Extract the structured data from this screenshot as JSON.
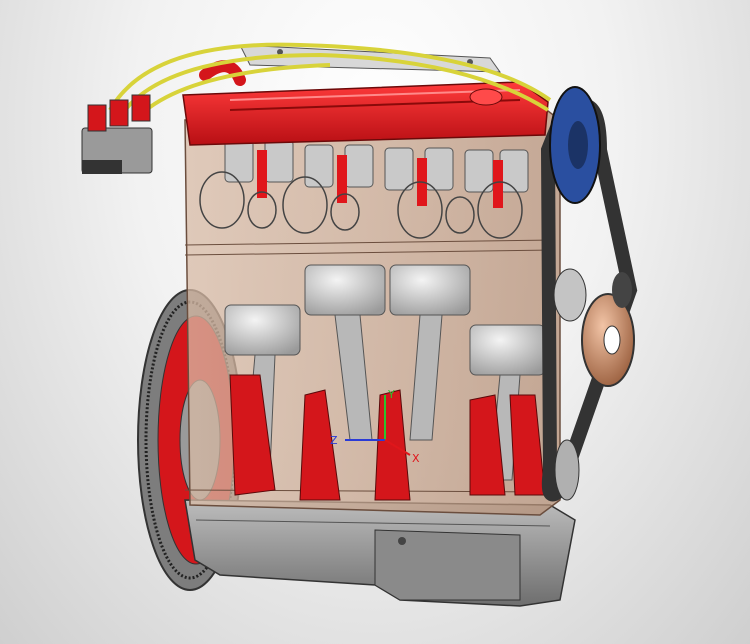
{
  "viewport": {
    "name": "CAD 3D viewport",
    "background_top": "#ffffff",
    "background_bottom": "#c8c8c8"
  },
  "model": {
    "description_hidden": "",
    "colors": {
      "valve_cover": "#e0161b",
      "block_glass": "#c9a58a",
      "steel": "#8d8d8d",
      "belt": "#3b3b3b",
      "pulley_blue": "#2a4fa0",
      "pulley_bronze": "#c98d6a",
      "wire": "#d8d33a",
      "pan": "#9c9c9c"
    }
  },
  "triad": {
    "x_label": "X",
    "y_label": "Y",
    "z_label": "Z"
  }
}
